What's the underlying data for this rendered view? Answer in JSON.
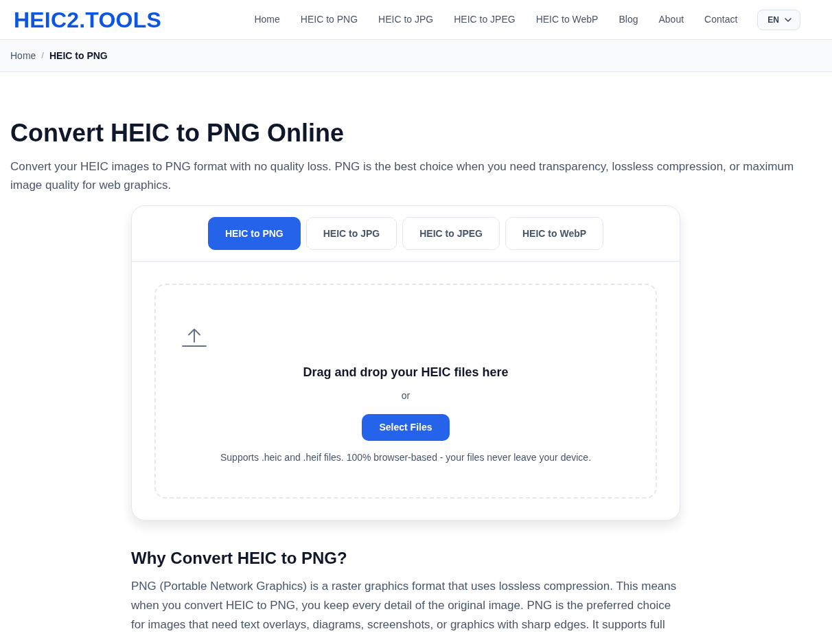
{
  "header": {
    "logo": "HEIC2.TOOLS",
    "nav": [
      {
        "label": "Home"
      },
      {
        "label": "HEIC to PNG"
      },
      {
        "label": "HEIC to JPG"
      },
      {
        "label": "HEIC to JPEG"
      },
      {
        "label": "HEIC to WebP"
      },
      {
        "label": "Blog"
      },
      {
        "label": "About"
      },
      {
        "label": "Contact"
      }
    ],
    "language": "EN"
  },
  "breadcrumb": {
    "separator": "/",
    "items": [
      {
        "label": "Home",
        "current": false
      },
      {
        "label": "HEIC to PNG",
        "current": true
      }
    ]
  },
  "hero": {
    "title": "Convert HEIC to PNG Online",
    "intro": "Convert your HEIC images to PNG format with no quality loss. PNG is the best choice when you need transparency, lossless compression, or maximum image quality for web graphics."
  },
  "converter": {
    "tabs": [
      {
        "label": "HEIC to PNG",
        "selected": true
      },
      {
        "label": "HEIC to JPG",
        "selected": false
      },
      {
        "label": "HEIC to JPEG",
        "selected": false
      },
      {
        "label": "HEIC to WebP",
        "selected": false
      }
    ],
    "dropzone": {
      "heading": "Drag and drop your HEIC files here",
      "separator": "or",
      "button": "Select Files",
      "note": "Supports .heic and .heif files. 100% browser-based - your files never leave your device."
    }
  },
  "section": {
    "title": "Why Convert HEIC to PNG?",
    "body": "PNG (Portable Network Graphics) is a raster graphics format that uses lossless compression. This means when you convert HEIC to PNG, you keep every detail of the original image. PNG is the preferred choice for images that need text overlays, diagrams, screenshots, or graphics with sharp edges. It supports full"
  }
}
